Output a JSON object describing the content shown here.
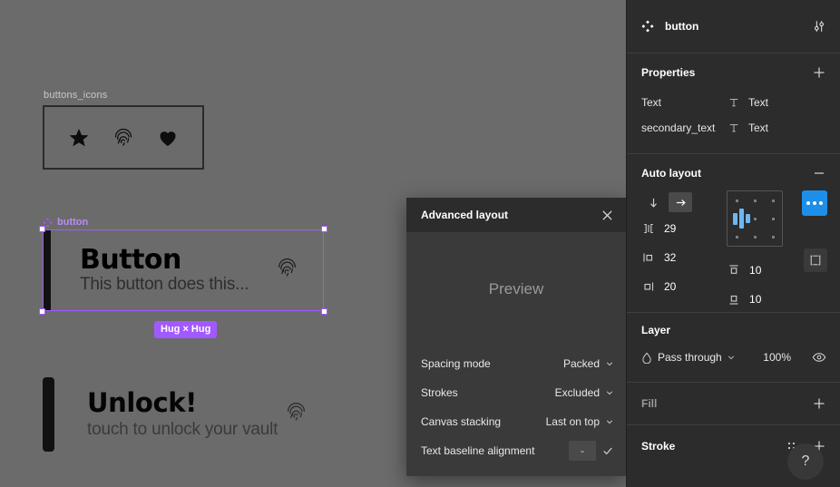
{
  "canvas": {
    "icons_frame": {
      "label": "buttons_icons",
      "icons": [
        "star-icon",
        "fingerprint-icon",
        "heart-icon"
      ]
    },
    "button_component": {
      "name": "button",
      "title": "Button",
      "subtitle": "This button does this...",
      "icon": "fingerprint-icon",
      "resize_badge": "Hug × Hug",
      "selection_color": "#a259ff"
    },
    "unlock_instance": {
      "title": "Unlock!",
      "subtitle": "touch to unlock your vault",
      "icon": "fingerprint-icon"
    },
    "background_color": "#6b6b6b"
  },
  "dialog": {
    "title": "Advanced layout",
    "close_icon": "close-icon",
    "preview_label": "Preview",
    "rows": [
      {
        "label": "Spacing mode",
        "value": "Packed",
        "control": "dropdown"
      },
      {
        "label": "Strokes",
        "value": "Excluded",
        "control": "dropdown"
      },
      {
        "label": "Canvas stacking",
        "value": "Last on top",
        "control": "dropdown"
      },
      {
        "label": "Text baseline alignment",
        "value": "-",
        "control": "toggle"
      }
    ]
  },
  "panel": {
    "header": {
      "icon": "component-set-icon",
      "name": "button",
      "settings_icon": "sliders-icon"
    },
    "properties": {
      "title": "Properties",
      "add_icon": "plus-icon",
      "rows": [
        {
          "name": "Text",
          "type_icon": "text-type-icon",
          "value": "Text"
        },
        {
          "name": "secondary_text",
          "type_icon": "text-type-icon",
          "value": "Text"
        }
      ]
    },
    "auto_layout": {
      "title": "Auto layout",
      "collapse_icon": "minus-icon",
      "direction_vertical_icon": "arrow-down-icon",
      "direction_horizontal_icon": "arrow-right-icon",
      "direction_active": "horizontal",
      "gap": "29",
      "gap_icon": "gap-horizontal-icon",
      "padding_left": "32",
      "padding_left_icon": "padding-left-icon",
      "padding_top": "10",
      "padding_top_icon": "padding-top-icon",
      "padding_right": "20",
      "padding_right_icon": "padding-right-icon",
      "padding_bottom": "10",
      "padding_bottom_icon": "padding-bottom-icon",
      "alignment": "middle-left",
      "more_icon": "ellipsis-icon",
      "more_color": "#1e8fe8",
      "clip_icon": "fit-content-icon"
    },
    "layer": {
      "title": "Layer",
      "blend_icon": "blend-mode-icon",
      "blend_mode": "Pass through",
      "chevron_icon": "chevron-down-icon",
      "opacity": "100%",
      "visibility_icon": "eye-icon"
    },
    "fill": {
      "title": "Fill",
      "add_icon": "plus-icon"
    },
    "stroke": {
      "title": "Stroke",
      "settings_icon": "stroke-style-icon",
      "add_icon": "plus-icon"
    },
    "help": {
      "label": "?",
      "name": "help-button"
    }
  }
}
